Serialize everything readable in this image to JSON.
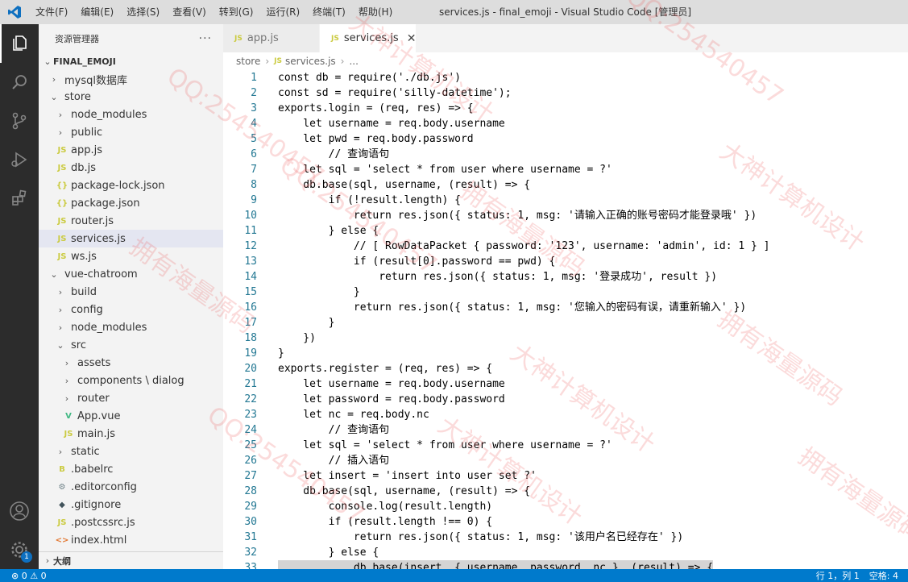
{
  "titlebar": {
    "menu": [
      "文件(F)",
      "编辑(E)",
      "选择(S)",
      "查看(V)",
      "转到(G)",
      "运行(R)",
      "终端(T)",
      "帮助(H)"
    ],
    "window_title": "services.js - final_emoji - Visual Studio Code [管理员]"
  },
  "activity": {
    "explorer": "explorer-icon",
    "search": "search-icon",
    "scm": "source-control-icon",
    "debug": "run-debug-icon",
    "extensions": "extensions-icon",
    "account": "account-icon",
    "settings": "gear-icon",
    "settings_badge": "1"
  },
  "sidebar": {
    "title": "资源管理器",
    "more": "···",
    "root": "FINAL_EMOJI",
    "items": [
      {
        "label": "mysql数据库",
        "type": "folder",
        "open": false
      },
      {
        "label": "store",
        "type": "folder",
        "open": true
      },
      {
        "label": "node_modules",
        "type": "folder",
        "open": false
      },
      {
        "label": "public",
        "type": "folder",
        "open": false
      },
      {
        "label": "app.js",
        "type": "js"
      },
      {
        "label": "db.js",
        "type": "js"
      },
      {
        "label": "package-lock.json",
        "type": "json"
      },
      {
        "label": "package.json",
        "type": "json"
      },
      {
        "label": "router.js",
        "type": "js"
      },
      {
        "label": "services.js",
        "type": "js",
        "selected": true
      },
      {
        "label": "ws.js",
        "type": "js"
      },
      {
        "label": "vue-chatroom",
        "type": "folder",
        "open": true
      },
      {
        "label": "build",
        "type": "folder",
        "open": false
      },
      {
        "label": "config",
        "type": "folder",
        "open": false
      },
      {
        "label": "node_modules",
        "type": "folder",
        "open": false
      },
      {
        "label": "src",
        "type": "folder",
        "open": true
      },
      {
        "label": "assets",
        "type": "folder",
        "open": false
      },
      {
        "label": "components \\ dialog",
        "type": "folder",
        "open": false
      },
      {
        "label": "router",
        "type": "folder",
        "open": false
      },
      {
        "label": "App.vue",
        "type": "vue"
      },
      {
        "label": "main.js",
        "type": "js"
      },
      {
        "label": "static",
        "type": "folder",
        "open": false
      },
      {
        "label": ".babelrc",
        "type": "babel"
      },
      {
        "label": ".editorconfig",
        "type": "config"
      },
      {
        "label": ".gitignore",
        "type": "git"
      },
      {
        "label": ".postcssrc.js",
        "type": "js"
      },
      {
        "label": "index.html",
        "type": "html"
      }
    ],
    "outline": "大纲"
  },
  "tabs": [
    {
      "label": "app.js",
      "active": false
    },
    {
      "label": "services.js",
      "active": true
    }
  ],
  "breadcrumb": [
    "store",
    "services.js",
    "..."
  ],
  "editor": {
    "lines": [
      {
        "n": "1",
        "t": "const db = require('./db.js')"
      },
      {
        "n": "2",
        "t": "const sd = require('silly-datetime');"
      },
      {
        "n": "3",
        "t": "exports.login = (req, res) => {"
      },
      {
        "n": "4",
        "t": "    let username = req.body.username"
      },
      {
        "n": "5",
        "t": "    let pwd = req.body.password"
      },
      {
        "n": "6",
        "t": "        // 查询语句"
      },
      {
        "n": "7",
        "t": "    let sql = 'select * from user where username = ?'"
      },
      {
        "n": "8",
        "t": "    db.base(sql, username, (result) => {"
      },
      {
        "n": "9",
        "t": "        if (!result.length) {"
      },
      {
        "n": "10",
        "t": "            return res.json({ status: 1, msg: '请输入正确的账号密码才能登录哦' })"
      },
      {
        "n": "11",
        "t": "        } else {"
      },
      {
        "n": "12",
        "t": "            // [ RowDataPacket { password: '123', username: 'admin', id: 1 } ]"
      },
      {
        "n": "13",
        "t": "            if (result[0].password == pwd) {"
      },
      {
        "n": "14",
        "t": "                return res.json({ status: 1, msg: '登录成功', result })"
      },
      {
        "n": "15",
        "t": "            }"
      },
      {
        "n": "16",
        "t": "            return res.json({ status: 1, msg: '您输入的密码有误，请重新输入' })"
      },
      {
        "n": "17",
        "t": "        }"
      },
      {
        "n": "18",
        "t": "    })"
      },
      {
        "n": "19",
        "t": "}"
      },
      {
        "n": "20",
        "t": "exports.register = (req, res) => {"
      },
      {
        "n": "21",
        "t": "    let username = req.body.username"
      },
      {
        "n": "22",
        "t": "    let password = req.body.password"
      },
      {
        "n": "23",
        "t": "    let nc = req.body.nc"
      },
      {
        "n": "24",
        "t": "        // 查询语句"
      },
      {
        "n": "25",
        "t": "    let sql = 'select * from user where username = ?'"
      },
      {
        "n": "26",
        "t": "        // 插入语句"
      },
      {
        "n": "27",
        "t": "    let insert = 'insert into user set ?'"
      },
      {
        "n": "28",
        "t": "    db.base(sql, username, (result) => {"
      },
      {
        "n": "29",
        "t": "        console.log(result.length)"
      },
      {
        "n": "30",
        "t": "        if (result.length !== 0) {"
      },
      {
        "n": "31",
        "t": "            return res.json({ status: 1, msg: '该用户名已经存在' })"
      },
      {
        "n": "32",
        "t": "        } else {"
      },
      {
        "n": "33",
        "t": "            db.base(insert, { username, password, nc }, (result) => {"
      }
    ]
  },
  "statusbar": {
    "problems": "⊗ 0 ⚠ 0",
    "position": "行 1，列 1",
    "spaces": "空格: 4"
  },
  "watermarks": [
    "QQ:254540457",
    "大神计算机设计",
    "拥有海量源码",
    "QQ:254540457",
    "大神计算机设计",
    "拥有海量源码",
    "QQ:254540457",
    "大神计算机设计",
    "拥有海量源码",
    "QQ:254540457",
    "大神计算机设计",
    "拥有海量源码"
  ]
}
